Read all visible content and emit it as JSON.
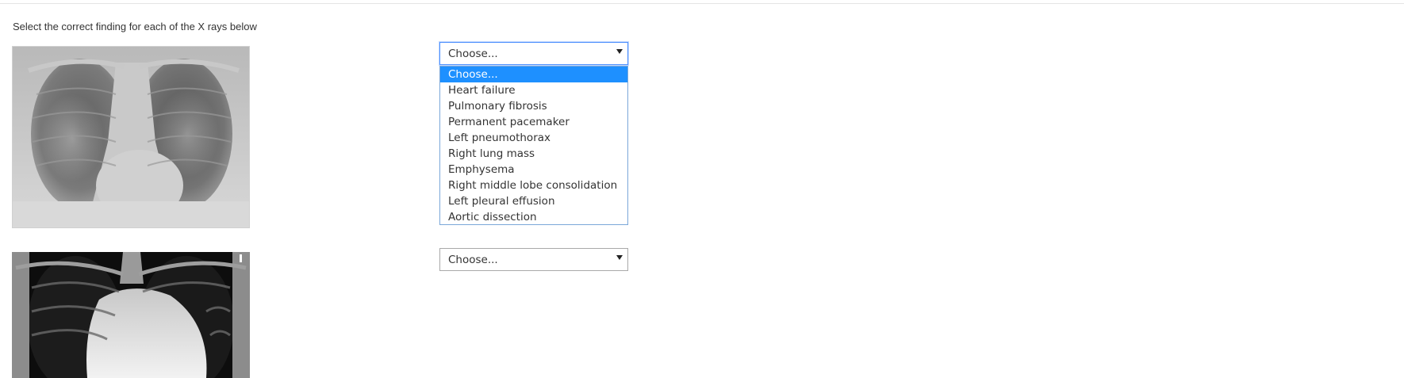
{
  "question": {
    "instruction": "Select the correct finding for each of the X rays below"
  },
  "items": [
    {
      "image": "chest-xray-bilateral-perihilar-opacities",
      "selected_value": "Choose..."
    },
    {
      "image": "chest-xray-enlarged-cardiac-silhouette",
      "selected_value": "Choose..."
    }
  ],
  "dropdown": {
    "open_for_item": 1,
    "highlighted_index": 0,
    "options": [
      "Choose...",
      "Heart failure",
      "Pulmonary fibrosis",
      "Permanent pacemaker",
      "Left pneumothorax",
      "Right lung mass",
      "Emphysema",
      "Right middle lobe consolidation",
      "Left pleural effusion",
      "Aortic dissection"
    ]
  },
  "colors": {
    "highlight": "#1e90ff",
    "focus_border": "#4d90fe",
    "dropdown_border": "#7aa7d9",
    "text": "#333333"
  }
}
